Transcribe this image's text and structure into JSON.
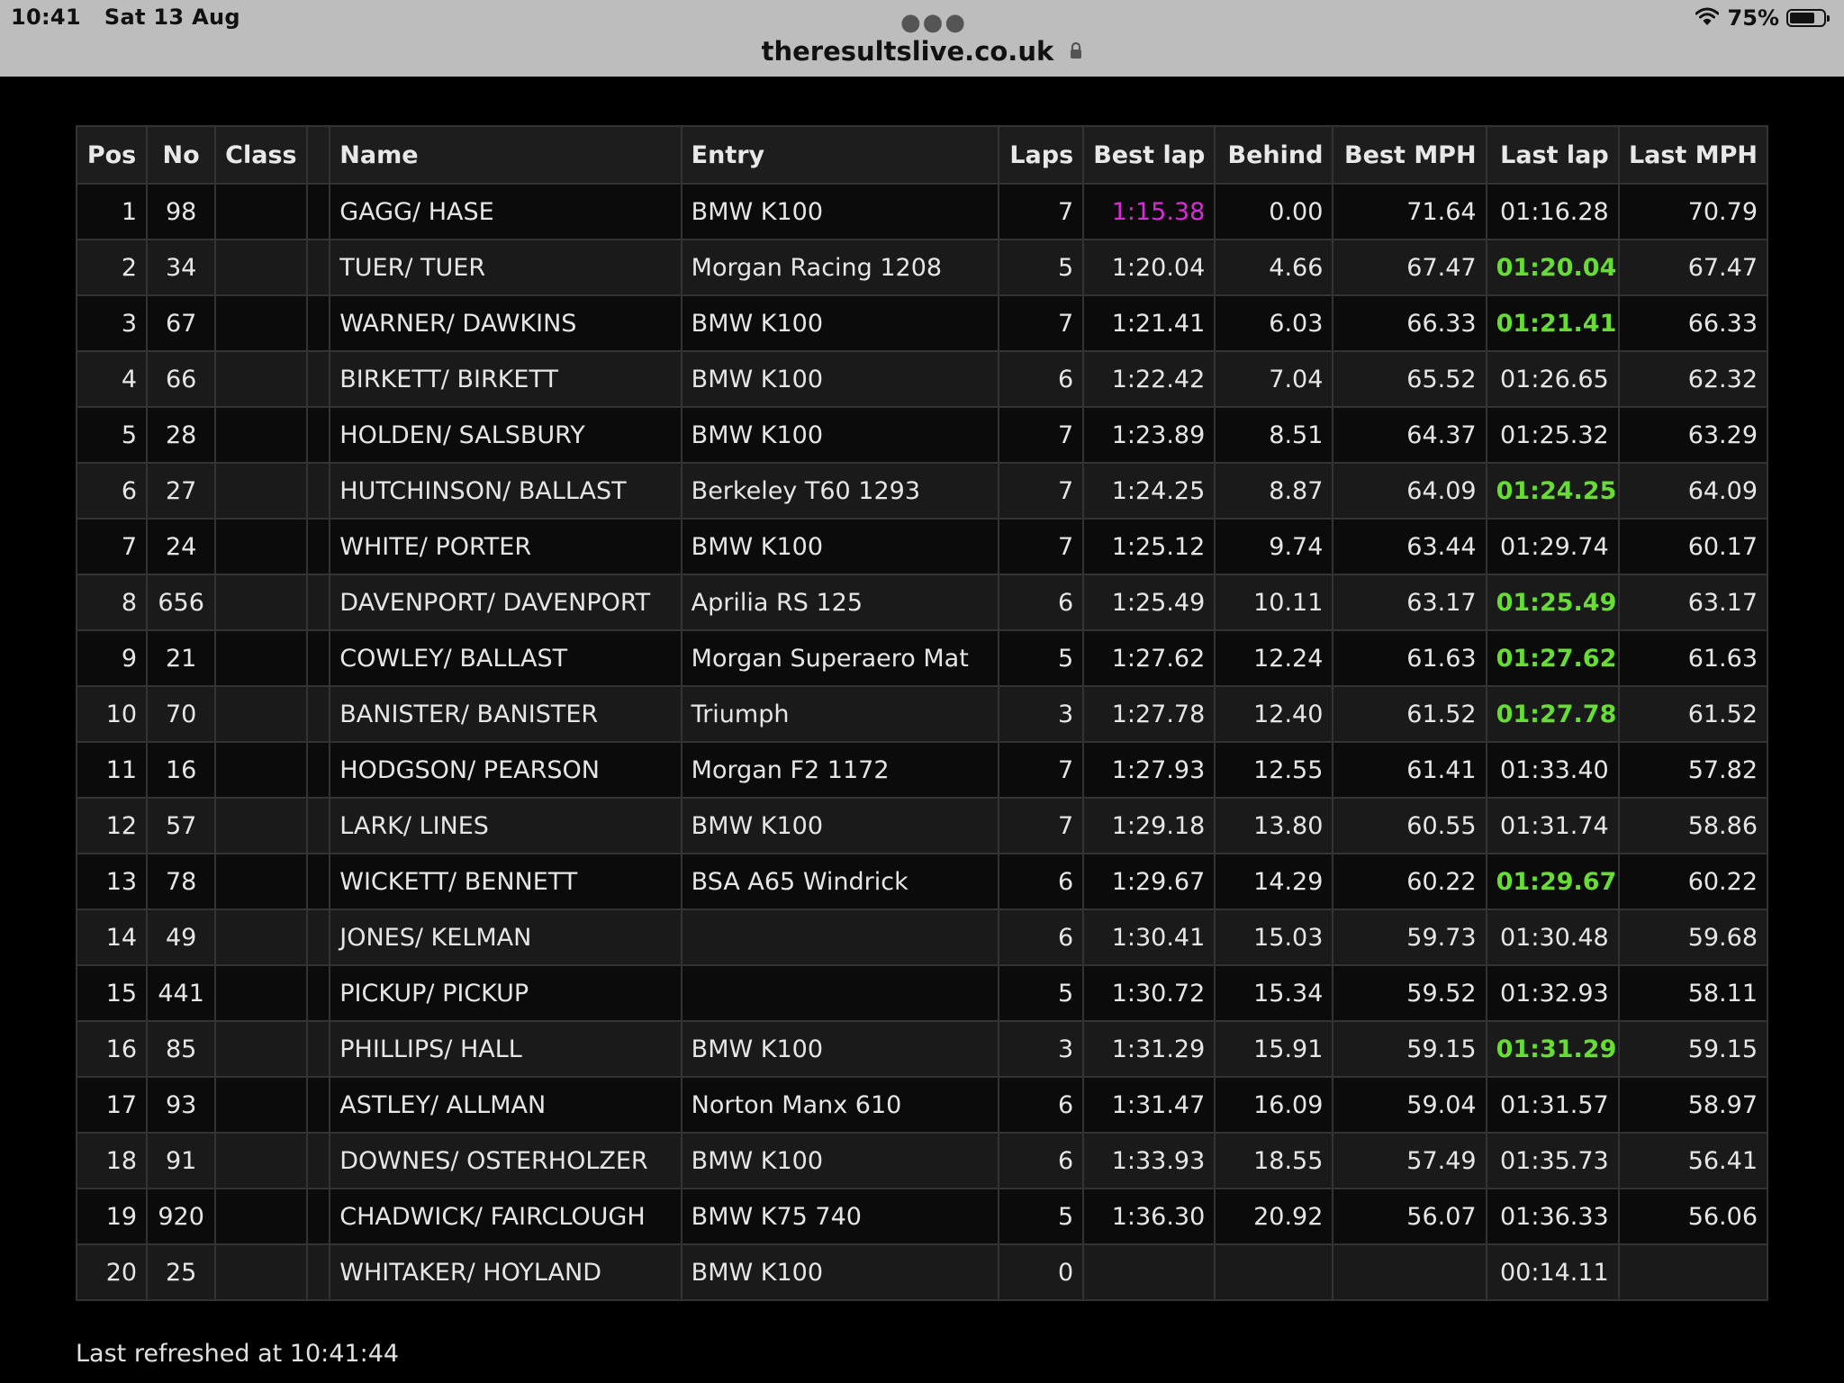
{
  "status_bar": {
    "time": "10:41",
    "date": "Sat 13 Aug",
    "url": "theresultslive.co.uk",
    "battery": "75%",
    "battery_level": 0.75
  },
  "table": {
    "headers": [
      "Pos",
      "No",
      "Class",
      "",
      "Name",
      "Entry",
      "Laps",
      "Best lap",
      "Behind",
      "Best MPH",
      "Last lap",
      "Last MPH"
    ],
    "rows": [
      {
        "pos": "1",
        "no": "98",
        "cls": "",
        "name": "GAGG/ HASE",
        "entry": "BMW K100",
        "laps": "7",
        "best_lap": "1:15.38",
        "behind": "0.00",
        "best_mph": "71.64",
        "last_lap": "01:16.28",
        "last_mph": "70.79",
        "best_hl": "fastest",
        "last_hl": ""
      },
      {
        "pos": "2",
        "no": "34",
        "cls": "",
        "name": "TUER/ TUER",
        "entry": "Morgan Racing 1208",
        "laps": "5",
        "best_lap": "1:20.04",
        "behind": "4.66",
        "best_mph": "67.47",
        "last_lap": "01:20.04",
        "last_mph": "67.47",
        "best_hl": "",
        "last_hl": "pb"
      },
      {
        "pos": "3",
        "no": "67",
        "cls": "",
        "name": "WARNER/ DAWKINS",
        "entry": "BMW K100",
        "laps": "7",
        "best_lap": "1:21.41",
        "behind": "6.03",
        "best_mph": "66.33",
        "last_lap": "01:21.41",
        "last_mph": "66.33",
        "best_hl": "",
        "last_hl": "pb"
      },
      {
        "pos": "4",
        "no": "66",
        "cls": "",
        "name": "BIRKETT/ BIRKETT",
        "entry": "BMW K100",
        "laps": "6",
        "best_lap": "1:22.42",
        "behind": "7.04",
        "best_mph": "65.52",
        "last_lap": "01:26.65",
        "last_mph": "62.32",
        "best_hl": "",
        "last_hl": ""
      },
      {
        "pos": "5",
        "no": "28",
        "cls": "",
        "name": "HOLDEN/ SALSBURY",
        "entry": "BMW K100",
        "laps": "7",
        "best_lap": "1:23.89",
        "behind": "8.51",
        "best_mph": "64.37",
        "last_lap": "01:25.32",
        "last_mph": "63.29",
        "best_hl": "",
        "last_hl": ""
      },
      {
        "pos": "6",
        "no": "27",
        "cls": "",
        "name": "HUTCHINSON/ BALLAST",
        "entry": "Berkeley T60 1293",
        "laps": "7",
        "best_lap": "1:24.25",
        "behind": "8.87",
        "best_mph": "64.09",
        "last_lap": "01:24.25",
        "last_mph": "64.09",
        "best_hl": "",
        "last_hl": "pb"
      },
      {
        "pos": "7",
        "no": "24",
        "cls": "",
        "name": "WHITE/ PORTER",
        "entry": "BMW K100",
        "laps": "7",
        "best_lap": "1:25.12",
        "behind": "9.74",
        "best_mph": "63.44",
        "last_lap": "01:29.74",
        "last_mph": "60.17",
        "best_hl": "",
        "last_hl": ""
      },
      {
        "pos": "8",
        "no": "656",
        "cls": "",
        "name": "DAVENPORT/ DAVENPORT",
        "entry": "Aprilia RS 125",
        "laps": "6",
        "best_lap": "1:25.49",
        "behind": "10.11",
        "best_mph": "63.17",
        "last_lap": "01:25.49",
        "last_mph": "63.17",
        "best_hl": "",
        "last_hl": "pb"
      },
      {
        "pos": "9",
        "no": "21",
        "cls": "",
        "name": "COWLEY/ BALLAST",
        "entry": "Morgan Superaero Mat",
        "laps": "5",
        "best_lap": "1:27.62",
        "behind": "12.24",
        "best_mph": "61.63",
        "last_lap": "01:27.62",
        "last_mph": "61.63",
        "best_hl": "",
        "last_hl": "pb"
      },
      {
        "pos": "10",
        "no": "70",
        "cls": "",
        "name": "BANISTER/ BANISTER",
        "entry": "Triumph",
        "laps": "3",
        "best_lap": "1:27.78",
        "behind": "12.40",
        "best_mph": "61.52",
        "last_lap": "01:27.78",
        "last_mph": "61.52",
        "best_hl": "",
        "last_hl": "pb"
      },
      {
        "pos": "11",
        "no": "16",
        "cls": "",
        "name": "HODGSON/ PEARSON",
        "entry": "Morgan F2 1172",
        "laps": "7",
        "best_lap": "1:27.93",
        "behind": "12.55",
        "best_mph": "61.41",
        "last_lap": "01:33.40",
        "last_mph": "57.82",
        "best_hl": "",
        "last_hl": ""
      },
      {
        "pos": "12",
        "no": "57",
        "cls": "",
        "name": "LARK/ LINES",
        "entry": "BMW K100",
        "laps": "7",
        "best_lap": "1:29.18",
        "behind": "13.80",
        "best_mph": "60.55",
        "last_lap": "01:31.74",
        "last_mph": "58.86",
        "best_hl": "",
        "last_hl": ""
      },
      {
        "pos": "13",
        "no": "78",
        "cls": "",
        "name": "WICKETT/ BENNETT",
        "entry": "BSA A65 Windrick",
        "laps": "6",
        "best_lap": "1:29.67",
        "behind": "14.29",
        "best_mph": "60.22",
        "last_lap": "01:29.67",
        "last_mph": "60.22",
        "best_hl": "",
        "last_hl": "pb"
      },
      {
        "pos": "14",
        "no": "49",
        "cls": "",
        "name": "JONES/ KELMAN",
        "entry": "",
        "laps": "6",
        "best_lap": "1:30.41",
        "behind": "15.03",
        "best_mph": "59.73",
        "last_lap": "01:30.48",
        "last_mph": "59.68",
        "best_hl": "",
        "last_hl": ""
      },
      {
        "pos": "15",
        "no": "441",
        "cls": "",
        "name": "PICKUP/ PICKUP",
        "entry": "",
        "laps": "5",
        "best_lap": "1:30.72",
        "behind": "15.34",
        "best_mph": "59.52",
        "last_lap": "01:32.93",
        "last_mph": "58.11",
        "best_hl": "",
        "last_hl": ""
      },
      {
        "pos": "16",
        "no": "85",
        "cls": "",
        "name": "PHILLIPS/ HALL",
        "entry": "BMW K100",
        "laps": "3",
        "best_lap": "1:31.29",
        "behind": "15.91",
        "best_mph": "59.15",
        "last_lap": "01:31.29",
        "last_mph": "59.15",
        "best_hl": "",
        "last_hl": "pb"
      },
      {
        "pos": "17",
        "no": "93",
        "cls": "",
        "name": "ASTLEY/ ALLMAN",
        "entry": "Norton Manx 610",
        "laps": "6",
        "best_lap": "1:31.47",
        "behind": "16.09",
        "best_mph": "59.04",
        "last_lap": "01:31.57",
        "last_mph": "58.97",
        "best_hl": "",
        "last_hl": ""
      },
      {
        "pos": "18",
        "no": "91",
        "cls": "",
        "name": "DOWNES/ OSTERHOLZER",
        "entry": "BMW K100",
        "laps": "6",
        "best_lap": "1:33.93",
        "behind": "18.55",
        "best_mph": "57.49",
        "last_lap": "01:35.73",
        "last_mph": "56.41",
        "best_hl": "",
        "last_hl": ""
      },
      {
        "pos": "19",
        "no": "920",
        "cls": "",
        "name": "CHADWICK/ FAIRCLOUGH",
        "entry": "BMW K75 740",
        "laps": "5",
        "best_lap": "1:36.30",
        "behind": "20.92",
        "best_mph": "56.07",
        "last_lap": "01:36.33",
        "last_mph": "56.06",
        "best_hl": "",
        "last_hl": ""
      },
      {
        "pos": "20",
        "no": "25",
        "cls": "",
        "name": "WHITAKER/ HOYLAND",
        "entry": "BMW K100",
        "laps": "0",
        "best_lap": "",
        "behind": "",
        "best_mph": "",
        "last_lap": "00:14.11",
        "last_mph": "",
        "best_hl": "",
        "last_hl": ""
      }
    ]
  },
  "footer": {
    "refreshed": "Last refreshed at 10:41:44"
  },
  "colors": {
    "fastest_lap": "#d92bd9",
    "personal_best": "#66dd33",
    "background": "#000000"
  }
}
